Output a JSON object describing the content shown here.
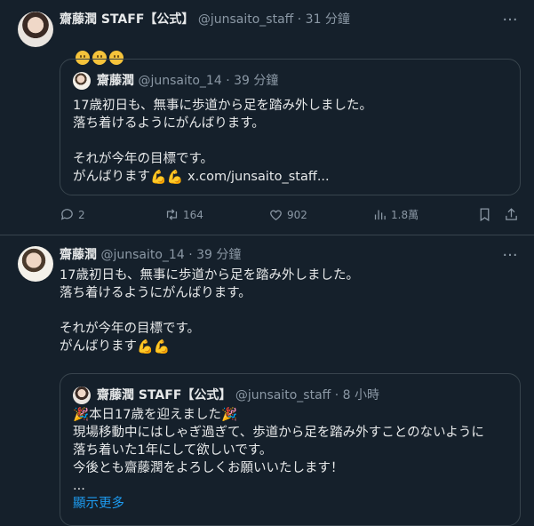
{
  "tweet1": {
    "author_name": "齋藤潤 STAFF【公式】",
    "handle": "@junsaito_staff",
    "time": "· 31 分鐘",
    "more": "···",
    "emojis": [
      "pleading-face",
      "pleading-face",
      "pleading-face"
    ],
    "quote": {
      "author_name": "齋藤潤",
      "handle": "@junsaito_14",
      "time": "· 39 分鐘",
      "lines": [
        "17歳初日も、無事に歩道から足を踏み外しました。",
        "落ち着けるようにがんばります。",
        "",
        "それが今年の目標です。"
      ],
      "last_line_text": "がんばります",
      "last_line_link": " x.com/junsaito_staff..."
    },
    "actions": {
      "reply_count": "2",
      "retweet_count": "164",
      "like_count": "902",
      "views": "1.8萬"
    }
  },
  "tweet2": {
    "author_name": "齋藤潤",
    "handle": "@junsaito_14",
    "time": "· 39 分鐘",
    "more": "···",
    "lines": [
      "17歳初日も、無事に歩道から足を踏み外しました。",
      "落ち着けるようにがんばります。",
      "",
      "それが今年の目標です。"
    ],
    "last_line_text": "がんばります",
    "quote": {
      "author_name": "齋藤潤 STAFF【公式】",
      "handle": "@junsaito_staff",
      "time": "· 8 小時",
      "first_line": "本日17歳を迎えました",
      "lines": [
        "現場移動中にはしゃぎ過ぎて、歩道から足を踏み外すことのないように",
        "落ち着いた1年にして欲しいです。",
        "今後とも齋藤潤をよろしくお願いいたします！",
        "..."
      ],
      "show_more": "顯示更多"
    }
  },
  "colors": {
    "background": "#15202b",
    "text": "#e7e9ea",
    "muted": "#8b98a5",
    "border": "#38444d",
    "link": "#1d9bf0"
  }
}
